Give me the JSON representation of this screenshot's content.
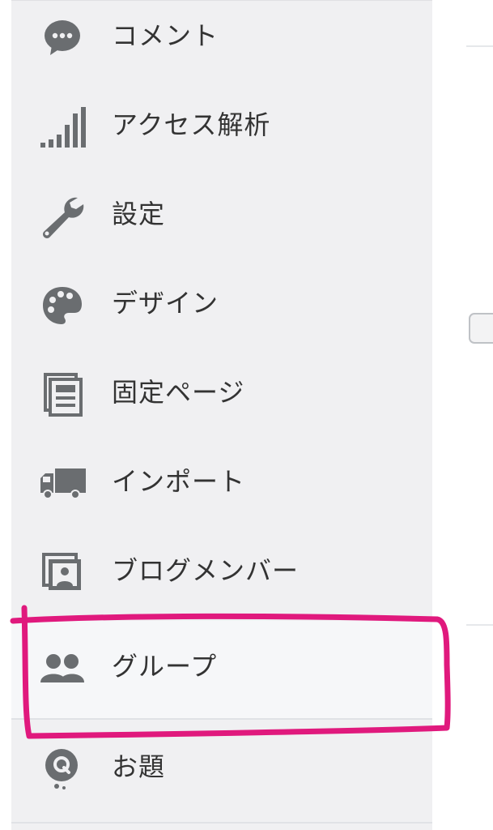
{
  "sidebar": {
    "items": [
      {
        "label": "コメント",
        "icon": "comment-bubble-icon"
      },
      {
        "label": "アクセス解析",
        "icon": "signal-bars-icon"
      },
      {
        "label": "設定",
        "icon": "wrench-icon"
      },
      {
        "label": "デザイン",
        "icon": "palette-icon"
      },
      {
        "label": "固定ページ",
        "icon": "page-document-icon"
      },
      {
        "label": "インポート",
        "icon": "truck-icon"
      },
      {
        "label": "ブログメンバー",
        "icon": "member-portrait-icon"
      },
      {
        "label": "グループ",
        "icon": "group-users-icon"
      },
      {
        "label": "お題",
        "icon": "q-bubble-icon"
      }
    ]
  },
  "annotation": {
    "color": "#e0197d"
  },
  "colors": {
    "sidebar_bg": "#f0f0f2",
    "icon": "#6a6d70",
    "text": "#333333"
  }
}
